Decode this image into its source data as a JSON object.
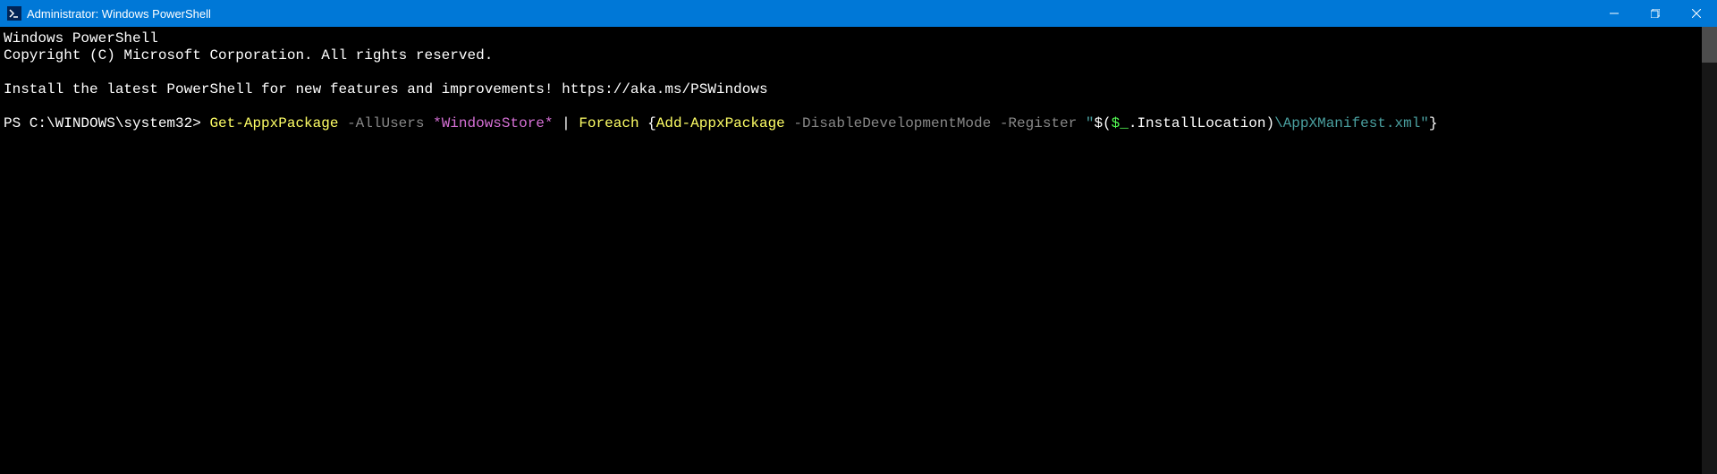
{
  "titlebar": {
    "title": "Administrator: Windows PowerShell"
  },
  "terminal": {
    "line1": "Windows PowerShell",
    "line2": "Copyright (C) Microsoft Corporation. All rights reserved.",
    "line3": "Install the latest PowerShell for new features and improvements! https://aka.ms/PSWindows",
    "prompt": "PS C:\\WINDOWS\\system32> ",
    "cmd1": "Get-AppxPackage",
    "param1": " -AllUsers",
    "lit1": " *WindowsStore*",
    "pipe": " | ",
    "cmd2": "Foreach",
    "brace_open": " {",
    "cmd3": "Add-AppxPackage",
    "param2": " -DisableDevelopmentMode",
    "param3": " -Register",
    "str_open": " \"",
    "subexpr_open": "$(",
    "var": "$_",
    "member": ".InstallLocation",
    "subexpr_close": ")",
    "str_rest": "\\AppXManifest.xml\"",
    "brace_close": "}"
  }
}
